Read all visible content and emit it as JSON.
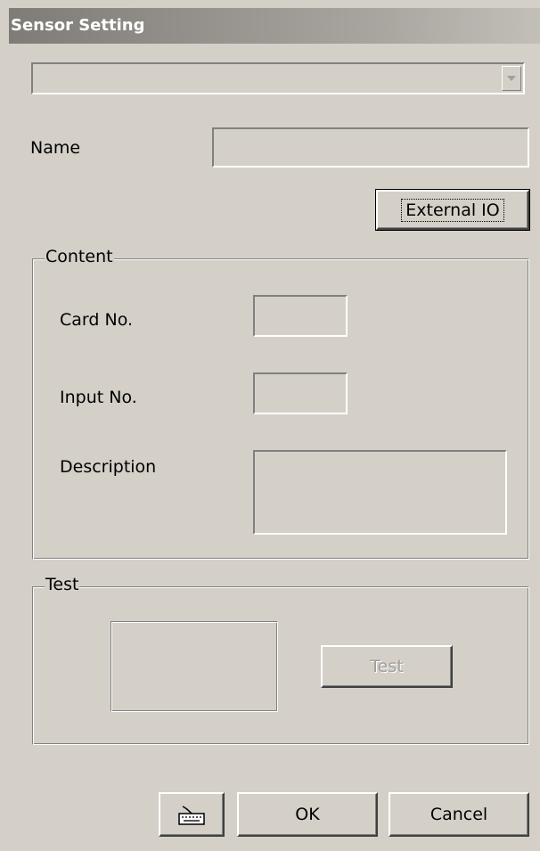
{
  "window": {
    "title": "Sensor Setting"
  },
  "selector": {
    "value": ""
  },
  "name": {
    "label": "Name",
    "value": ""
  },
  "buttons": {
    "external_io": "External IO",
    "ok": "OK",
    "cancel": "Cancel",
    "keyboard_icon": "keyboard-icon"
  },
  "content": {
    "legend": "Content",
    "card_no_label": "Card No.",
    "card_no_value": "",
    "input_no_label": "Input No.",
    "input_no_value": "",
    "description_label": "Description",
    "description_value": ""
  },
  "test": {
    "legend": "Test",
    "button": "Test"
  },
  "colors": {
    "face": "#d4d0c8",
    "title_gradient_start": "#7f7c77",
    "disabled_text": "#a0a0a0"
  }
}
